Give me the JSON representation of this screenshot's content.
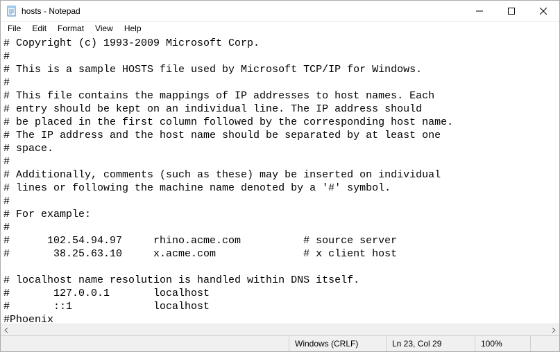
{
  "window": {
    "title": "hosts - Notepad"
  },
  "menu": {
    "file": "File",
    "edit": "Edit",
    "format": "Format",
    "view": "View",
    "help": "Help"
  },
  "document": {
    "content": "# Copyright (c) 1993-2009 Microsoft Corp.\n#\n# This is a sample HOSTS file used by Microsoft TCP/IP for Windows.\n#\n# This file contains the mappings of IP addresses to host names. Each\n# entry should be kept on an individual line. The IP address should\n# be placed in the first column followed by the corresponding host name.\n# The IP address and the host name should be separated by at least one\n# space.\n#\n# Additionally, comments (such as these) may be inserted on individual\n# lines or following the machine name denoted by a '#' symbol.\n#\n# For example:\n#\n#      102.54.94.97     rhino.acme.com          # source server\n#       38.25.63.10     x.acme.com              # x client host\n\n# localhost name resolution is handled within DNS itself.\n#\t127.0.0.1       localhost\n#\t::1             localhost\n#Phoenix"
  },
  "status": {
    "line_ending": "Windows (CRLF)",
    "cursor": "Ln 23, Col 29",
    "zoom": "100%",
    "encoding": ""
  }
}
